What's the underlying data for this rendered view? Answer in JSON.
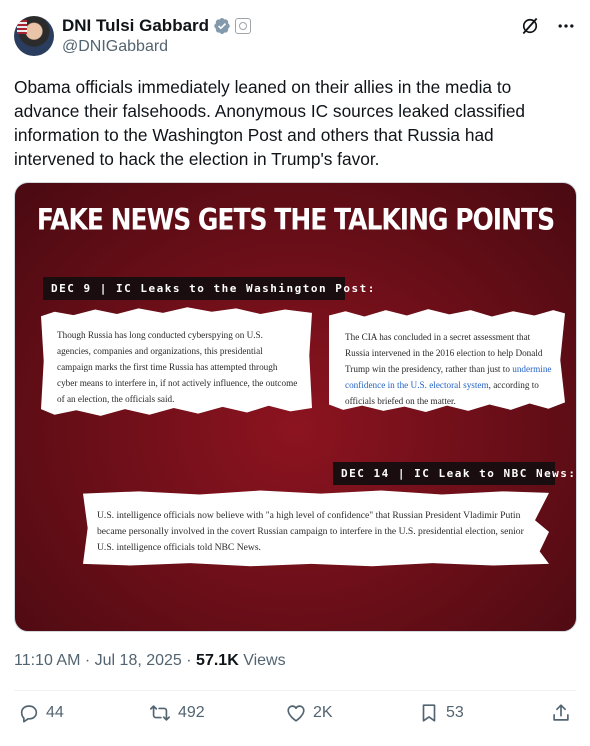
{
  "author": {
    "display_name": "DNI Tulsi Gabbard",
    "handle": "@DNIGabbard"
  },
  "tweet": {
    "text": "Obama officials immediately leaned on their allies in the media to advance their falsehoods. Anonymous IC sources leaked classified information to the Washington Post and others that Russia had intervened to hack the election in Trump's favor."
  },
  "media": {
    "title": "FAKE NEWS GETS THE TALKING POINTS",
    "label_1": "DEC 9 | IC Leaks to the Washington Post:",
    "clip_1": "Though Russia has long conducted cyberspying on U.S. agencies, companies and organizations, this presidential campaign marks the first time Russia has attempted through cyber means to interfere in, if not actively influence, the outcome of an election, the officials said.",
    "clip_2_before": "The CIA has concluded in a secret assessment that Russia intervened in the 2016 election to help Donald Trump win the presidency, rather than just to ",
    "clip_2_link": "undermine confidence in the U.S. electoral system",
    "clip_2_after": ", according to officials briefed on the matter.",
    "label_2": "DEC 14 | IC Leak to NBC News:",
    "clip_3": "U.S. intelligence officials now believe with \"a high level of confidence\" that Russian President Vladimir Putin became personally involved in the covert Russian campaign to interfere in the U.S. presidential election, senior U.S. intelligence officials told NBC News."
  },
  "meta": {
    "time": "11:10 AM",
    "separator": " · ",
    "date": "Jul 18, 2025",
    "separator_2": " · ",
    "views_count": "57.1K",
    "views_label": " Views"
  },
  "actions": {
    "replies": "44",
    "reposts": "492",
    "likes": "2K",
    "bookmarks": "53"
  },
  "colors": {
    "text": "#0f1419",
    "secondary": "#536471",
    "verified": "#829aab",
    "media_background": "#6f0f19",
    "link": "#2563c4"
  },
  "icons": [
    "verified-badge-icon",
    "government-badge-icon",
    "grok-icon",
    "more-icon",
    "reply-icon",
    "repost-icon",
    "like-icon",
    "bookmark-icon",
    "share-icon"
  ]
}
